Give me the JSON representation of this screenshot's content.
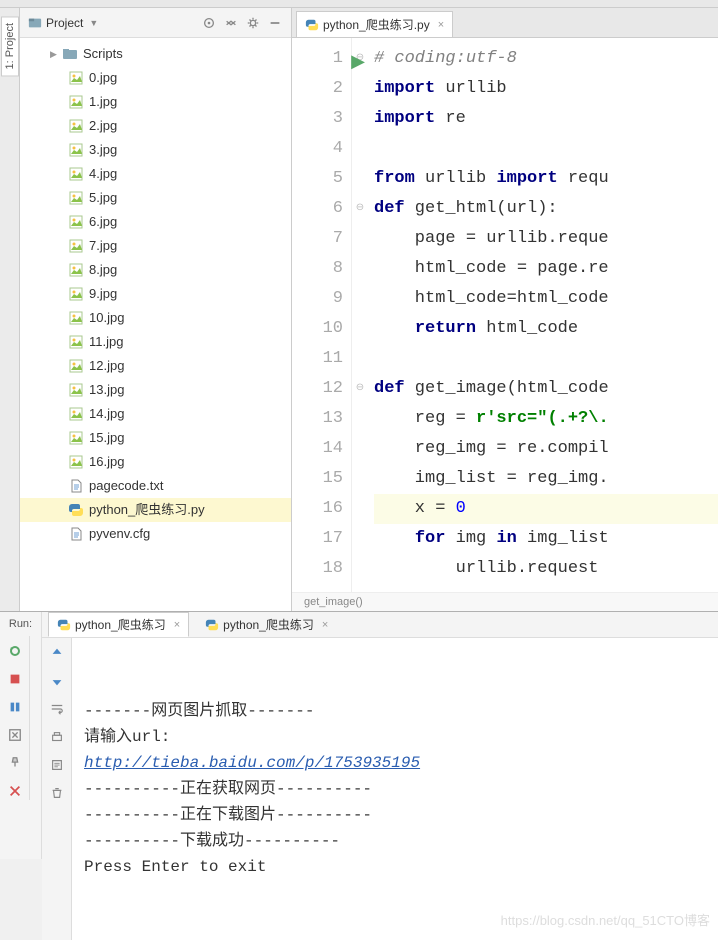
{
  "sidebar_tab": "1: Project",
  "project_panel": {
    "title": "Project",
    "folder": "Scripts",
    "files": [
      {
        "name": "0.jpg",
        "type": "img"
      },
      {
        "name": "1.jpg",
        "type": "img"
      },
      {
        "name": "2.jpg",
        "type": "img"
      },
      {
        "name": "3.jpg",
        "type": "img"
      },
      {
        "name": "4.jpg",
        "type": "img"
      },
      {
        "name": "5.jpg",
        "type": "img"
      },
      {
        "name": "6.jpg",
        "type": "img"
      },
      {
        "name": "7.jpg",
        "type": "img"
      },
      {
        "name": "8.jpg",
        "type": "img"
      },
      {
        "name": "9.jpg",
        "type": "img"
      },
      {
        "name": "10.jpg",
        "type": "img"
      },
      {
        "name": "11.jpg",
        "type": "img"
      },
      {
        "name": "12.jpg",
        "type": "img"
      },
      {
        "name": "13.jpg",
        "type": "img"
      },
      {
        "name": "14.jpg",
        "type": "img"
      },
      {
        "name": "15.jpg",
        "type": "img"
      },
      {
        "name": "16.jpg",
        "type": "img"
      },
      {
        "name": "pagecode.txt",
        "type": "txt"
      },
      {
        "name": "python_爬虫练习.py",
        "type": "py",
        "selected": true
      },
      {
        "name": "pyvenv.cfg",
        "type": "txt"
      }
    ]
  },
  "editor": {
    "tab_label": "python_爬虫练习.py",
    "breadcrumb": "get_image()",
    "lines": [
      {
        "n": 1,
        "run": true,
        "html": "<span class='c-comment'># coding:utf-8</span>"
      },
      {
        "n": 2,
        "html": "<span class='c-keyword'>import</span> urllib"
      },
      {
        "n": 3,
        "html": "<span class='c-keyword'>import</span> re"
      },
      {
        "n": 4,
        "html": ""
      },
      {
        "n": 5,
        "html": "<span class='c-keyword'>from</span> urllib <span class='c-keyword'>import</span> requ"
      },
      {
        "n": 6,
        "fold": true,
        "html": "<span class='c-keyword'>def</span> get_html(url):"
      },
      {
        "n": 7,
        "html": "    page = urllib.reque"
      },
      {
        "n": 8,
        "html": "    html_code = page.re"
      },
      {
        "n": 9,
        "html": "    html_code=html_code"
      },
      {
        "n": 10,
        "html": "    <span class='c-keyword'>return</span> html_code"
      },
      {
        "n": 11,
        "html": ""
      },
      {
        "n": 12,
        "fold": true,
        "html": "<span class='c-keyword'>def</span> get_image(html_code"
      },
      {
        "n": 13,
        "html": "    reg = <span class='c-string'>r'src=\"(.+?\\.</span>"
      },
      {
        "n": 14,
        "html": "    reg_img = re.compil"
      },
      {
        "n": 15,
        "html": "    img_list = reg_img."
      },
      {
        "n": 16,
        "highlight": true,
        "html": "    x = <span class='c-num'>0</span>"
      },
      {
        "n": 17,
        "html": "    <span class='c-keyword'>for</span> img <span class='c-keyword'>in</span> img_list"
      },
      {
        "n": 18,
        "partial": true,
        "html": "        urllib.request"
      }
    ]
  },
  "run": {
    "label": "Run:",
    "tabs": [
      {
        "label": "python_爬虫练习",
        "active": true
      },
      {
        "label": "python_爬虫练习",
        "active": false
      }
    ],
    "console_lines": [
      {
        "text": "-------网页图片抓取-------"
      },
      {
        "text": "请输入url:"
      },
      {
        "text": "http://tieba.baidu.com/p/1753935195",
        "link": true
      },
      {
        "text": "----------正在获取网页----------"
      },
      {
        "text": "----------正在下载图片----------"
      },
      {
        "text": "----------下载成功----------"
      },
      {
        "text": "Press Enter to exit"
      }
    ],
    "watermark": "https://blog.csdn.net/qq_51CTO博客"
  }
}
